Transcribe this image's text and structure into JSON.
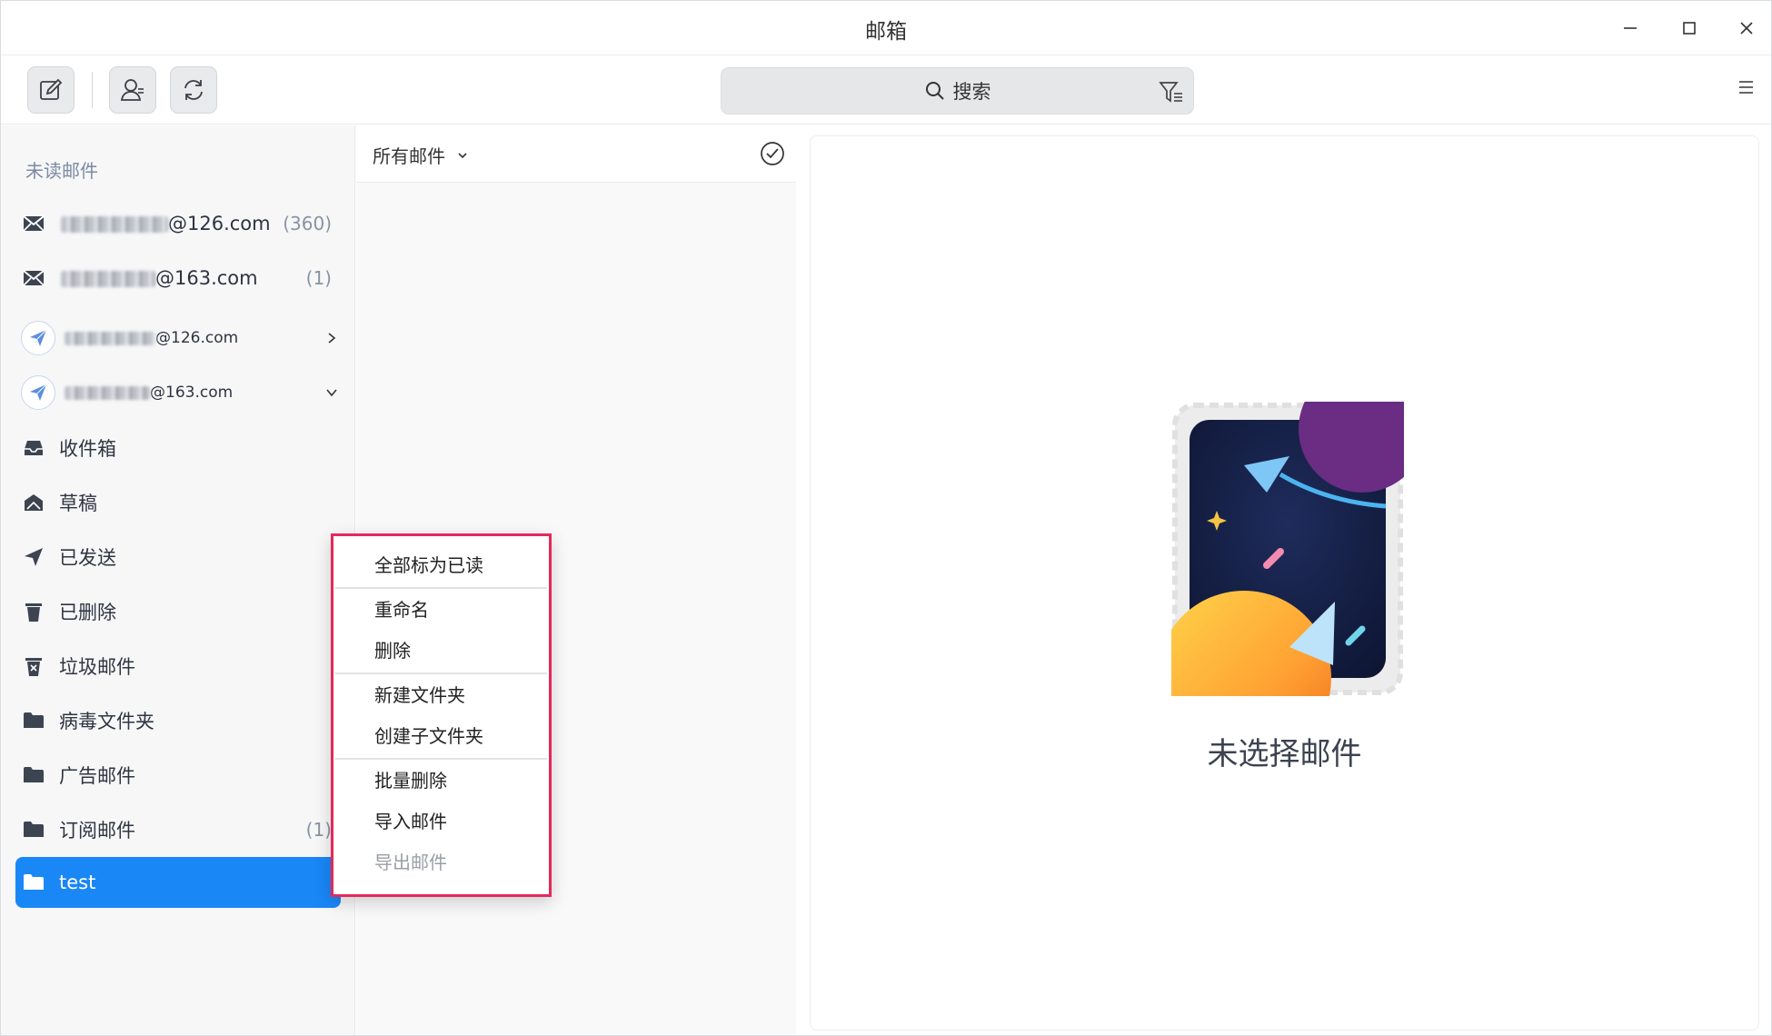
{
  "window": {
    "title": "邮箱"
  },
  "toolbar": {
    "search_placeholder": "搜索"
  },
  "sidebar": {
    "section_title": "未读邮件",
    "unread_accounts": [
      {
        "suffix": "@126.com",
        "count": "(360)"
      },
      {
        "suffix": "@163.com",
        "count": "(1)"
      }
    ],
    "accounts": [
      {
        "suffix": "@126.com",
        "state": "collapsed"
      },
      {
        "suffix": "@163.com",
        "state": "expanded"
      }
    ],
    "folders": [
      {
        "label": "收件箱",
        "icon": "inbox-icon",
        "count": ""
      },
      {
        "label": "草稿",
        "icon": "draft-icon",
        "count": ""
      },
      {
        "label": "已发送",
        "icon": "sent-icon",
        "count": ""
      },
      {
        "label": "已删除",
        "icon": "trash-icon",
        "count": ""
      },
      {
        "label": "垃圾邮件",
        "icon": "spam-icon",
        "count": ""
      },
      {
        "label": "病毒文件夹",
        "icon": "folder-icon",
        "count": ""
      },
      {
        "label": "广告邮件",
        "icon": "folder-icon",
        "count": ""
      },
      {
        "label": "订阅邮件",
        "icon": "folder-icon",
        "count": "(1)"
      },
      {
        "label": "test",
        "icon": "folder-icon",
        "count": "",
        "selected": true
      }
    ],
    "selected_color": "#1a87f7"
  },
  "list": {
    "filter_label": "所有邮件"
  },
  "reader": {
    "empty_text": "未选择邮件"
  },
  "context_menu": {
    "items": [
      {
        "label": "全部标为已读",
        "enabled": true
      },
      {
        "label": "重命名",
        "enabled": true
      },
      {
        "label": "删除",
        "enabled": true
      },
      {
        "label": "新建文件夹",
        "enabled": true
      },
      {
        "label": "创建子文件夹",
        "enabled": true
      },
      {
        "label": "批量删除",
        "enabled": true
      },
      {
        "label": "导入邮件",
        "enabled": true
      },
      {
        "label": "导出邮件",
        "enabled": false
      }
    ],
    "highlight_color": "#e6285a"
  }
}
